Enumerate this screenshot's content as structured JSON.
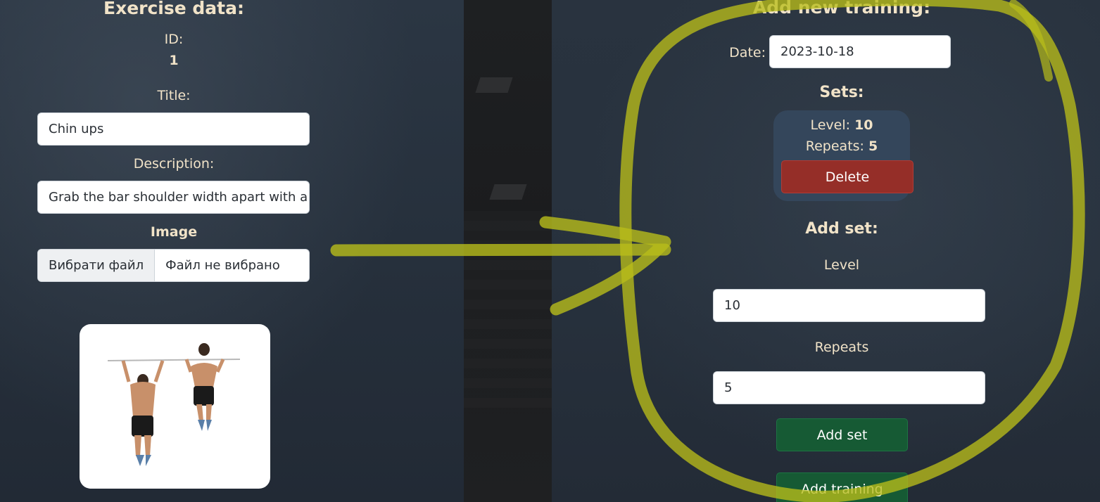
{
  "exercise": {
    "heading": "Exercise data:",
    "id_label": "ID:",
    "id_value": "1",
    "title_label": "Title:",
    "title_value": "Chin ups",
    "description_label": "Description:",
    "description_value": "Grab the bar shoulder width apart with a",
    "image_label": "Image",
    "file_button_label": "Вибрати файл",
    "file_status": "Файл не вибрано",
    "image_icon": "chin-ups-illustration"
  },
  "training": {
    "heading": "Add new training:",
    "date_label": "Date:",
    "date_value": "2023-10-18",
    "sets_heading": "Sets:",
    "sets": [
      {
        "level_label": "Level:",
        "level": "10",
        "repeats_label": "Repeats:",
        "repeats": "5",
        "delete_label": "Delete"
      }
    ],
    "add_set_heading": "Add set:",
    "level_label": "Level",
    "level_value": "10",
    "repeats_label": "Repeats",
    "repeats_value": "5",
    "add_set_button": "Add set",
    "add_training_button": "Add training"
  },
  "colors": {
    "text": "#f1e3c8",
    "danger": "#952e28",
    "success": "#165a34",
    "card": "#34465b",
    "annotation": "#b8bd1a"
  }
}
